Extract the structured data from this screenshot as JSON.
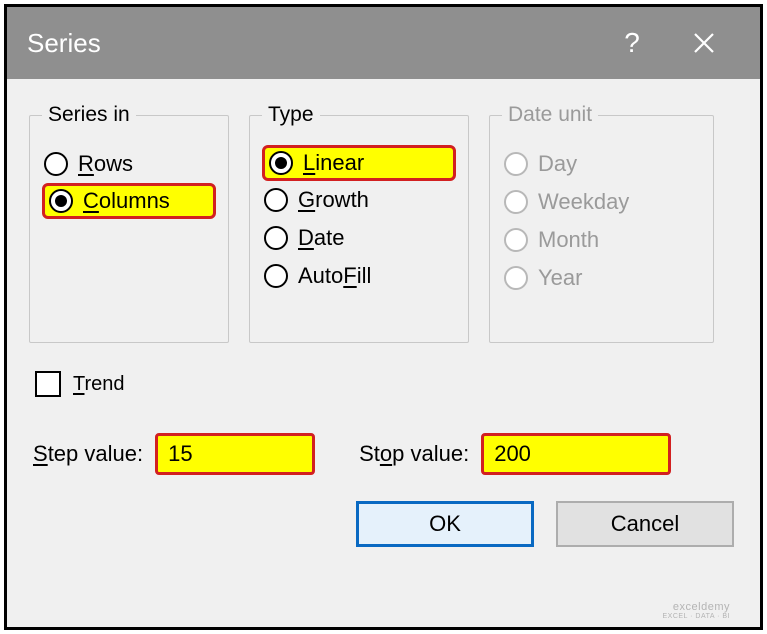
{
  "titlebar": {
    "title": "Series"
  },
  "groups": {
    "series_in": {
      "legend": "Series in",
      "rows": "Rows",
      "columns": "Columns",
      "selected": "columns"
    },
    "type": {
      "legend": "Type",
      "linear": "Linear",
      "growth": "Growth",
      "date": "Date",
      "autofill": "AutoFill",
      "selected": "linear"
    },
    "date_unit": {
      "legend": "Date unit",
      "day": "Day",
      "weekday": "Weekday",
      "month": "Month",
      "year": "Year",
      "enabled": false
    }
  },
  "trend": {
    "label": "Trend",
    "checked": false
  },
  "step": {
    "label": "Step value:",
    "value": "15"
  },
  "stop": {
    "label": "Stop value:",
    "value": "200"
  },
  "buttons": {
    "ok": "OK",
    "cancel": "Cancel"
  },
  "watermark": {
    "line1": "exceldemy",
    "line2": "EXCEL · DATA · BI"
  }
}
